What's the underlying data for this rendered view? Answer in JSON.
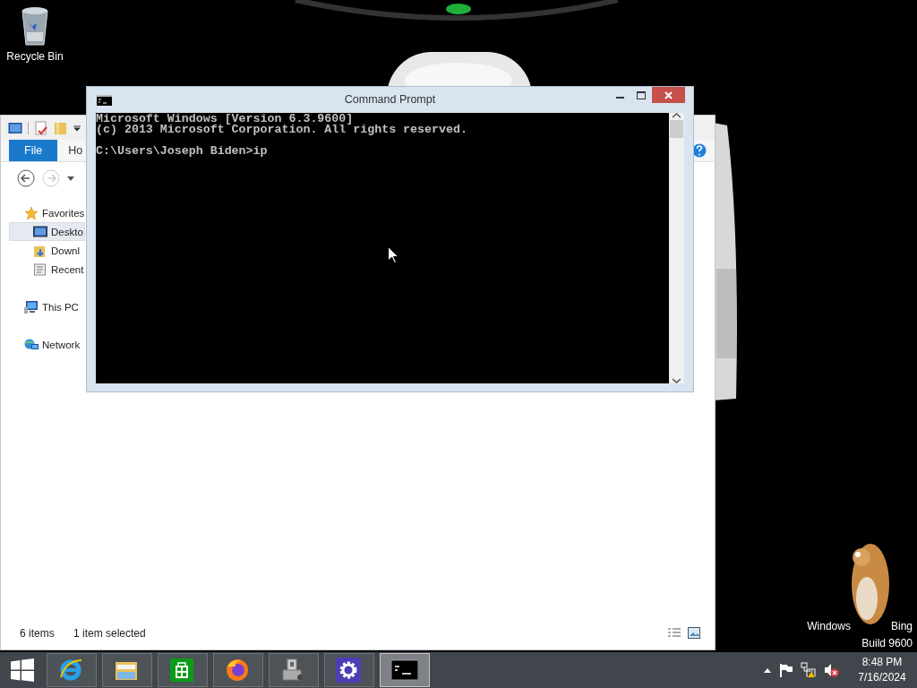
{
  "desktop": {
    "icons": [
      {
        "label": "Recycle Bin"
      }
    ],
    "watermark": {
      "line_1_left": "Windows",
      "line_1_right": "Bing",
      "line_2": "Build 9600"
    }
  },
  "explorer_window": {
    "ribbon_tabs": [
      {
        "label": "File",
        "selected": true
      },
      {
        "label": "Ho",
        "selected": false
      }
    ],
    "nav_pane": {
      "items": [
        {
          "label": "Favorites",
          "kind": "star",
          "selected": false,
          "children": [
            {
              "label": "Deskto",
              "kind": "desktop",
              "selected": true
            },
            {
              "label": "Downl",
              "kind": "downloads",
              "selected": false
            },
            {
              "label": "Recent",
              "kind": "recent",
              "selected": false
            }
          ]
        },
        {
          "label": "This PC",
          "kind": "pc",
          "selected": false
        },
        {
          "label": "Network",
          "kind": "network",
          "selected": false
        }
      ]
    },
    "status_bar": {
      "item_count": "6 items",
      "selection": "1 item selected"
    }
  },
  "cmd_window": {
    "title": "Command Prompt",
    "blocks": [
      {
        "lines": [
          "Microsoft Windows [Version 6.3.9600]",
          "(c) 2013 Microsoft Corporation. All rights reserved."
        ]
      },
      {
        "lines": [
          "C:\\Users\\Joseph Biden>ip"
        ]
      }
    ]
  },
  "taskbar": {
    "apps": [
      {
        "kind": "ie",
        "selected": false
      },
      {
        "kind": "explorer",
        "selected": false
      },
      {
        "kind": "store",
        "selected": false
      },
      {
        "kind": "firefox",
        "selected": false
      },
      {
        "kind": "device",
        "selected": false
      },
      {
        "kind": "settings",
        "selected": false
      },
      {
        "kind": "console",
        "selected": true
      }
    ]
  },
  "tray": {
    "network_warning": true,
    "volume_muted": true,
    "time": "8:48 PM",
    "date": "7/16/2024"
  }
}
